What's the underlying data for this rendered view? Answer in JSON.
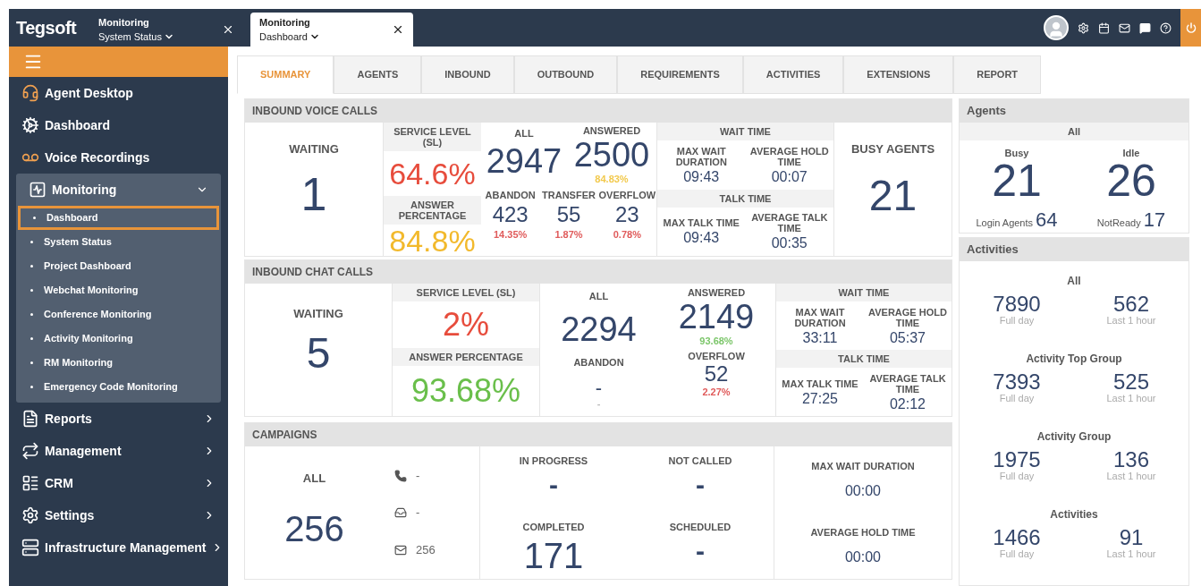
{
  "header": {
    "logo": "Tegsoft",
    "tabs": [
      {
        "title": "Monitoring",
        "subtitle": "System Status",
        "selected": false
      },
      {
        "title": "Monitoring",
        "subtitle": "Dashboard",
        "selected": true
      }
    ]
  },
  "sidebar": {
    "items": [
      {
        "label": "Agent Desktop"
      },
      {
        "label": "Dashboard"
      },
      {
        "label": "Voice Recordings"
      },
      {
        "label": "Monitoring",
        "expanded": true,
        "children": [
          {
            "label": "Dashboard",
            "selected": true
          },
          {
            "label": "System Status",
            "selected": false
          },
          {
            "label": "Project Dashboard",
            "selected": false
          },
          {
            "label": "Webchat Monitoring",
            "selected": false
          },
          {
            "label": "Conference Monitoring",
            "selected": false
          },
          {
            "label": "Activity Monitoring",
            "selected": false
          },
          {
            "label": "RM Monitoring",
            "selected": false
          },
          {
            "label": "Emergency Code Monitoring",
            "selected": false
          }
        ]
      },
      {
        "label": "Reports",
        "expanded": false
      },
      {
        "label": "Management",
        "expanded": false
      },
      {
        "label": "CRM",
        "expanded": false
      },
      {
        "label": "Settings",
        "expanded": false
      },
      {
        "label": "Infrastructure Management",
        "expanded": false
      }
    ]
  },
  "tabs": [
    {
      "label": "SUMMARY",
      "selected": true
    },
    {
      "label": "AGENTS",
      "selected": false
    },
    {
      "label": "INBOUND",
      "selected": false
    },
    {
      "label": "OUTBOUND",
      "selected": false
    },
    {
      "label": "REQUIREMENTS",
      "selected": false
    },
    {
      "label": "ACTIVITIES",
      "selected": false
    },
    {
      "label": "EXTENSIONS",
      "selected": false
    },
    {
      "label": "REPORT",
      "selected": false
    }
  ],
  "inbound_voice": {
    "title": "INBOUND VOICE CALLS",
    "waiting": {
      "label": "WAITING",
      "value": "1"
    },
    "service_level": {
      "label": "SERVICE LEVEL (SL)",
      "value": "64.6%",
      "color": "#e74c3c"
    },
    "answer_percentage": {
      "label": "ANSWER PERCENTAGE",
      "value": "84.8%",
      "color": "#f2b92c"
    },
    "all": {
      "label": "ALL",
      "value": "2947"
    },
    "answered": {
      "label": "ANSWERED",
      "value": "2500",
      "percent": {
        "text": "84.83%",
        "color": "#f2c94c"
      }
    },
    "breakdown": [
      {
        "label": "ABANDON",
        "value": "423",
        "percent": {
          "text": "14.35%",
          "color": "#e05b5b"
        }
      },
      {
        "label": "TRANSFER",
        "value": "55",
        "percent": {
          "text": "1.87%",
          "color": "#e05b5b"
        }
      },
      {
        "label": "OVERFLOW",
        "value": "23",
        "percent": {
          "text": "0.78%",
          "color": "#e05b5b"
        }
      }
    ],
    "wait_time": {
      "label": "WAIT TIME",
      "items": [
        {
          "label": "MAX WAIT DURATION",
          "value": "09:43"
        },
        {
          "label": "AVERAGE HOLD TIME",
          "value": "00:07"
        }
      ]
    },
    "talk_time": {
      "label": "TALK TIME",
      "items": [
        {
          "label": "MAX TALK TIME",
          "value": "09:43"
        },
        {
          "label": "AVERAGE TALK TIME",
          "value": "00:35"
        }
      ]
    },
    "busy_agents": {
      "label": "BUSY AGENTS",
      "value": "21"
    }
  },
  "inbound_chat": {
    "title": "INBOUND CHAT CALLS",
    "waiting": {
      "label": "WAITING",
      "value": "5"
    },
    "service_level": {
      "label": "SERVICE LEVEL (SL)",
      "value": "2%",
      "color": "#e74c3c"
    },
    "answer_percentage": {
      "label": "ANSWER PERCENTAGE",
      "value": "93.68%",
      "color": "#6abf4b"
    },
    "all": {
      "label": "ALL",
      "value": "2294"
    },
    "abandon": {
      "label": "ABANDON",
      "value": "-",
      "percent": {
        "text": "-",
        "color": "#bbbbbb"
      }
    },
    "answered": {
      "label": "ANSWERED",
      "value": "2149",
      "percent": {
        "text": "93.68%",
        "color": "#7cc66a"
      }
    },
    "overflow": {
      "label": "OVERFLOW",
      "value": "52",
      "percent": {
        "text": "2.27%",
        "color": "#e05b5b"
      }
    },
    "wait_time": {
      "label": "WAIT TIME",
      "items": [
        {
          "label": "MAX WAIT DURATION",
          "value": "33:11"
        },
        {
          "label": "AVERAGE HOLD TIME",
          "value": "05:37"
        }
      ]
    },
    "talk_time": {
      "label": "TALK TIME",
      "items": [
        {
          "label": "MAX TALK TIME",
          "value": "27:25"
        },
        {
          "label": "AVERAGE TALK TIME",
          "value": "02:12"
        }
      ]
    }
  },
  "campaigns": {
    "title": "CAMPAIGNS",
    "all": {
      "label": "ALL",
      "value": "256"
    },
    "channels": [
      {
        "value": "-"
      },
      {
        "value": "-"
      },
      {
        "value": "256"
      }
    ],
    "statuses": [
      {
        "label": "IN PROGRESS",
        "value": "-"
      },
      {
        "label": "NOT CALLED",
        "value": "-"
      },
      {
        "label": "COMPLETED",
        "value": "171"
      },
      {
        "label": "SCHEDULED",
        "value": "-"
      }
    ],
    "times": [
      {
        "label": "MAX WAIT DURATION",
        "value": "00:00"
      },
      {
        "label": "AVERAGE HOLD TIME",
        "value": "00:00"
      }
    ]
  },
  "agents": {
    "title": "Agents",
    "subtitle": "All",
    "counts": [
      {
        "label": "Busy",
        "value": "21",
        "sub_label": "Login Agents",
        "sub_value": "64"
      },
      {
        "label": "Idle",
        "value": "26",
        "sub_label": "NotReady",
        "sub_value": "17"
      }
    ]
  },
  "activities": {
    "title": "Activities",
    "groups": [
      {
        "label": "All",
        "stats": [
          {
            "value": "7890",
            "caption": "Full day"
          },
          {
            "value": "562",
            "caption": "Last 1 hour"
          }
        ]
      },
      {
        "label": "Activity Top Group",
        "stats": [
          {
            "value": "7393",
            "caption": "Full day"
          },
          {
            "value": "525",
            "caption": "Last 1 hour"
          }
        ]
      },
      {
        "label": "Activity Group",
        "stats": [
          {
            "value": "1975",
            "caption": "Full day"
          },
          {
            "value": "136",
            "caption": "Last 1 hour"
          }
        ]
      },
      {
        "label": "Activities",
        "stats": [
          {
            "value": "1466",
            "caption": "Full day"
          },
          {
            "value": "91",
            "caption": "Last 1 hour"
          }
        ]
      }
    ]
  }
}
